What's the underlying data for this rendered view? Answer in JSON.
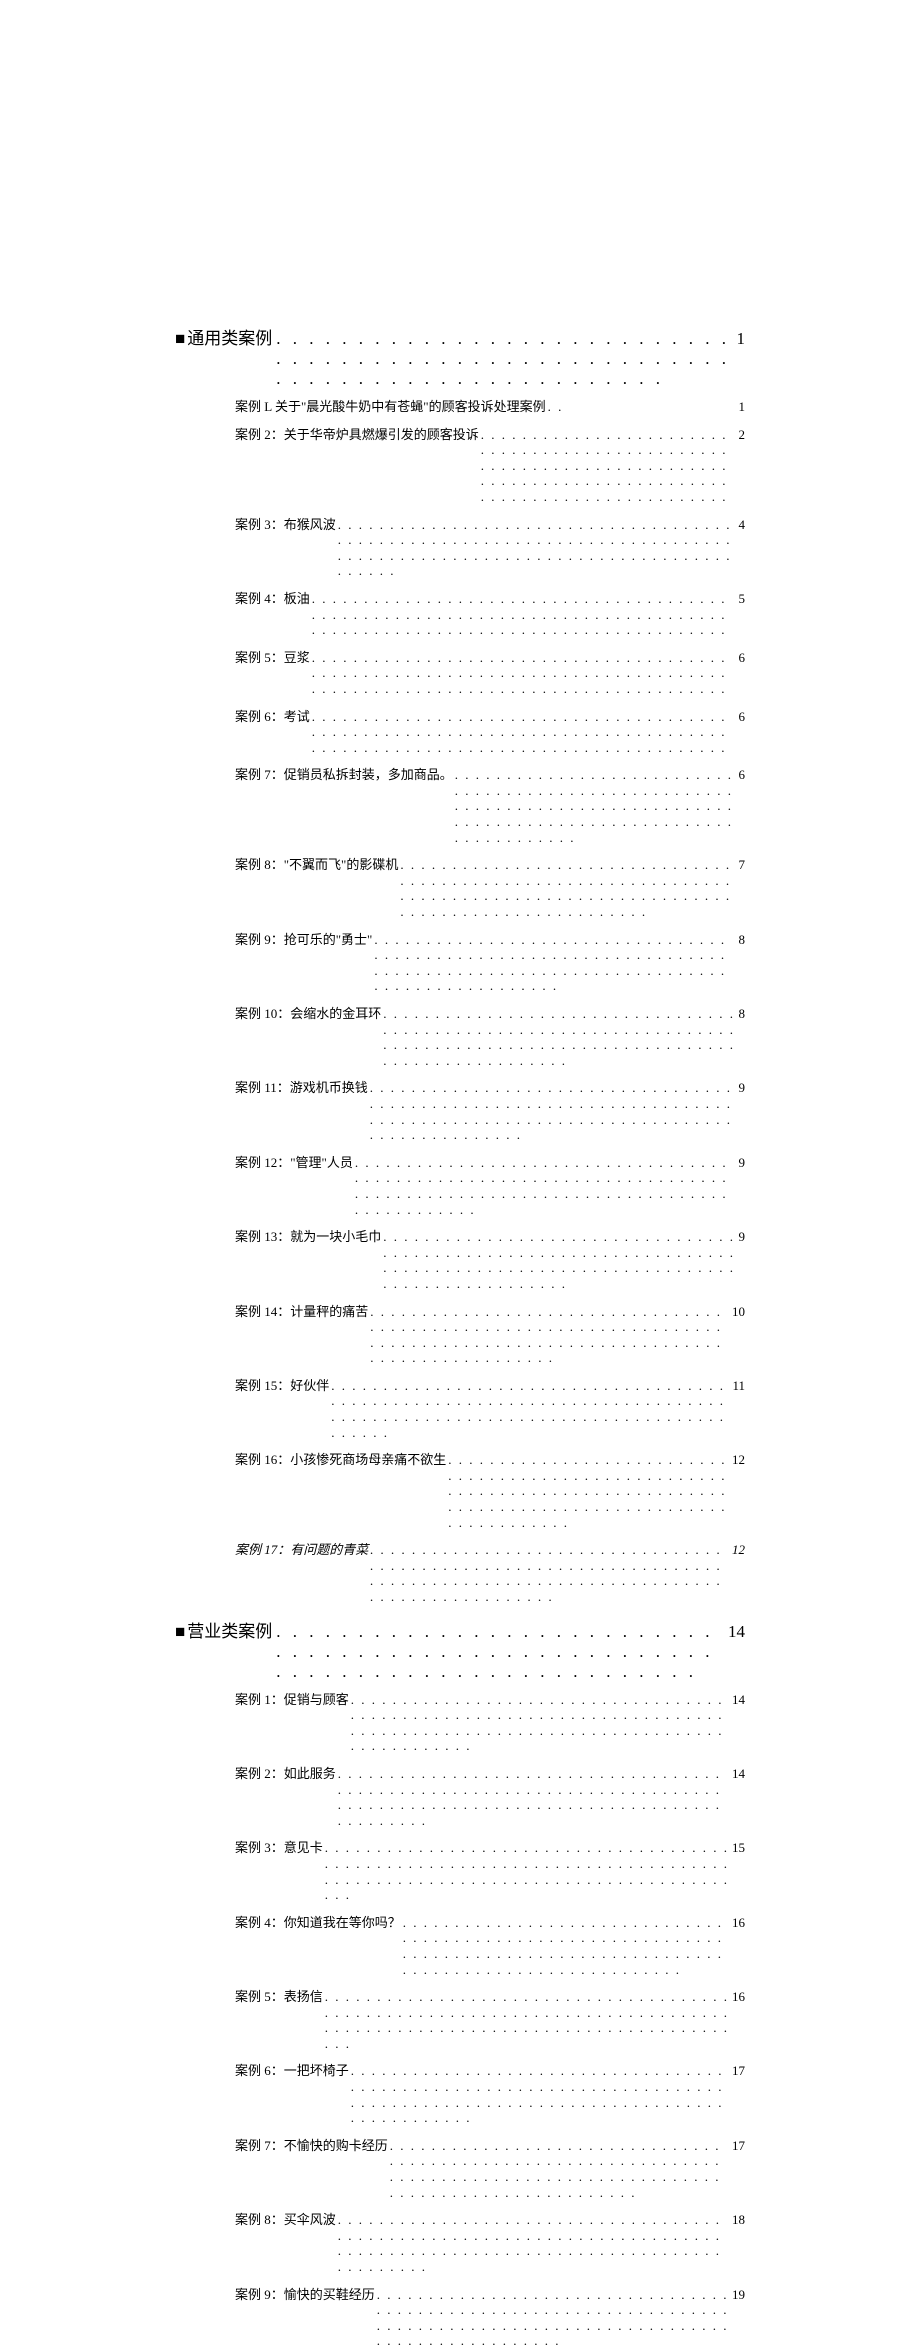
{
  "sections": [
    {
      "marker": "■",
      "title": "通用类案例",
      "page": "1",
      "items": [
        {
          "label": "案例 L 关于\"晨光酸牛奶中有苍蝇\"的顾客投诉处理案例",
          "page": "1"
        },
        {
          "label": "案例 2：关于华帝炉具燃爆引发的顾客投诉",
          "page": "2"
        },
        {
          "label": "案例 3：布猴风波",
          "page": "4"
        },
        {
          "label": "案例 4：板油",
          "page": "5"
        },
        {
          "label": "案例 5：豆浆",
          "page": "6"
        },
        {
          "label": "案例 6：考试",
          "page": "6"
        },
        {
          "label": "案例 7：促销员私拆封装，多加商品。",
          "page": "6"
        },
        {
          "label": "案例 8：\"不翼而飞\"的影碟机",
          "page": "7"
        },
        {
          "label": "案例 9：抢可乐的\"勇士\"",
          "page": "8"
        },
        {
          "label": "案例 10：会缩水的金耳环",
          "page": "8"
        },
        {
          "label": "案例 11：游戏机币换钱",
          "page": "9"
        },
        {
          "label": "案例 12：\"管理\"人员",
          "page": "9"
        },
        {
          "label": "案例 13：就为一块小毛巾",
          "page": "9"
        },
        {
          "label": "案例 14：计量秤的痛苦",
          "page": "10"
        },
        {
          "label": "案例 15：好伙伴",
          "page": "11"
        },
        {
          "label": "案例 16：小孩惨死商场母亲痛不欲生",
          "page": "12"
        },
        {
          "label": "案例 17：有问题的青菜",
          "page": "12",
          "italic": true
        }
      ]
    },
    {
      "marker": "■",
      "title": "营业类案例",
      "page": "14",
      "items": [
        {
          "label": "案例 1：促销与顾客",
          "page": "14"
        },
        {
          "label": "案例 2：如此服务",
          "page": "14"
        },
        {
          "label": "案例 3：意见卡",
          "page": "15"
        },
        {
          "label": "案例 4：你知道我在等你吗？",
          "page": "16"
        },
        {
          "label": "案例 5：表扬信",
          "page": "16"
        },
        {
          "label": "案例 6：一把坏椅子",
          "page": "17"
        },
        {
          "label": "案例 7：不愉快的购卡经历",
          "page": "17"
        },
        {
          "label": "案例 8：买伞风波",
          "page": "18"
        },
        {
          "label": "案例 9：愉快的买鞋经历",
          "page": "19"
        }
      ]
    }
  ],
  "dots_section": ". . . . . . . . . . . . . . . . . . . . . . . . . . . . . . . . . . . . . . . . . . . . . . . . . . . . . . . . . . . . . . . . . . . . . . . . . . . . . . . .",
  "dots_item": ". . . . . . . . . . . . . . . . . . . . . . . . . . . . . . . . . . . . . . . . . . . . . . . . . . . . . . . . . . . . . . . . . . . . . . . . . . . . . . . . . . . . . . . . . . . . . . . . . . . . . . . . . . . . . . . . . . . . . . . ."
}
